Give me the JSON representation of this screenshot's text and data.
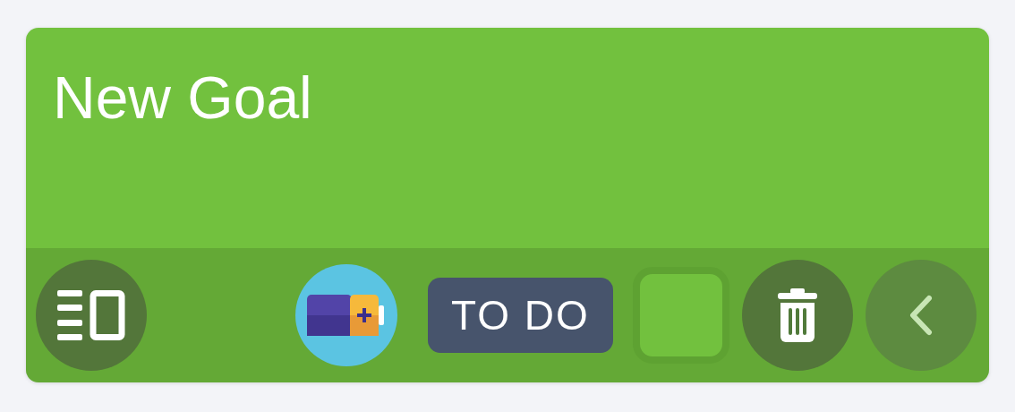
{
  "card": {
    "title": "New Goal",
    "color": "#72c13e"
  },
  "toolbar": {
    "status": "TO DO"
  }
}
